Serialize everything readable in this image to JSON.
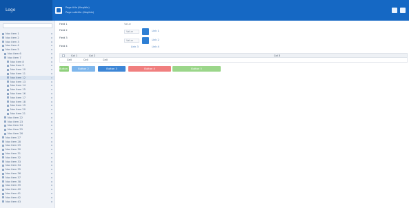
{
  "header": {
    "brand": "Logo",
    "line1": "Page title (illegible)",
    "line2": "Page subtitle (illegible)"
  },
  "sidebar": {
    "items": [
      {
        "label": "Nav item 1"
      },
      {
        "label": "Nav item 2"
      },
      {
        "label": "Nav item 3"
      },
      {
        "label": "Nav item 4"
      },
      {
        "label": "Nav item 5"
      },
      {
        "label": "Nav item 6"
      },
      {
        "label": "Nav item 7"
      },
      {
        "label": "Nav item 8"
      },
      {
        "label": "Nav item 9"
      },
      {
        "label": "Nav item 10"
      },
      {
        "label": "Nav item 11"
      },
      {
        "label": "Nav item 12"
      },
      {
        "label": "Nav item 13"
      },
      {
        "label": "Nav item 14"
      },
      {
        "label": "Nav item 15"
      },
      {
        "label": "Nav item 16"
      },
      {
        "label": "Nav item 17"
      },
      {
        "label": "Nav item 18"
      },
      {
        "label": "Nav item 19"
      },
      {
        "label": "Nav item 20"
      },
      {
        "label": "Nav item 21"
      },
      {
        "label": "Nav item 22"
      },
      {
        "label": "Nav item 23"
      },
      {
        "label": "Nav item 24"
      },
      {
        "label": "Nav item 25"
      },
      {
        "label": "Nav item 26"
      },
      {
        "label": "Nav item 27"
      },
      {
        "label": "Nav item 28"
      },
      {
        "label": "Nav item 29"
      },
      {
        "label": "Nav item 30"
      },
      {
        "label": "Nav item 31"
      },
      {
        "label": "Nav item 32"
      },
      {
        "label": "Nav item 33"
      },
      {
        "label": "Nav item 34"
      },
      {
        "label": "Nav item 35"
      },
      {
        "label": "Nav item 36"
      },
      {
        "label": "Nav item 37"
      },
      {
        "label": "Nav item 38"
      },
      {
        "label": "Nav item 39"
      },
      {
        "label": "Nav item 40"
      },
      {
        "label": "Nav item 41"
      },
      {
        "label": "Nav item 42"
      },
      {
        "label": "Nav item 43"
      }
    ]
  },
  "form": {
    "row1_label": "Field 1",
    "row1_value": "Value",
    "row2_label": "Field 2",
    "row2_input": "Value",
    "row2_link": "Link 1",
    "row3_label": "Field 3",
    "row3_input": "Value",
    "row3_link": "Link 2",
    "row4_label": "Field 4",
    "row4_link1": "Link 3",
    "row4_link2": "Link 4"
  },
  "table": {
    "headers": [
      "Col 1",
      "Col 2",
      "Col 3"
    ],
    "rows": [
      [
        "Cell",
        "Cell",
        "Cell"
      ]
    ]
  },
  "actions": {
    "btn1": "Button 1",
    "btn2": "Button 2",
    "btn3": "Button 3",
    "btn4": "Button 4",
    "btn5": "Button 5"
  },
  "colors": {
    "header": "#1568c4",
    "brand": "#0d55a8",
    "btn_green": "#8fd07c",
    "btn_blue": "#7eb6ec",
    "btn_blue_dark": "#3d86d6",
    "btn_red": "#f07f7f",
    "btn_green2": "#9bd68a"
  }
}
